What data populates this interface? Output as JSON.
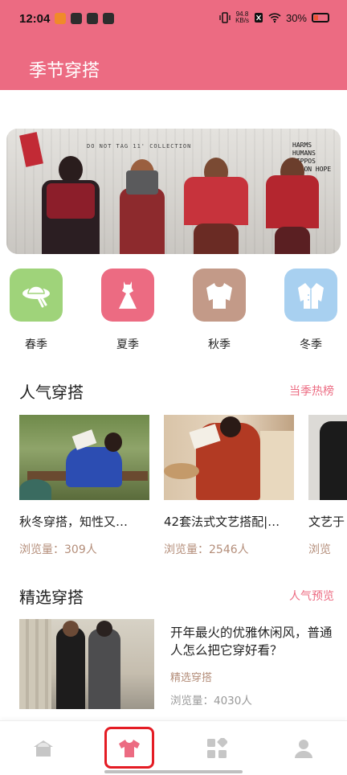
{
  "status_bar": {
    "time": "12:04",
    "speed_value": "94.8",
    "speed_unit": "KB/s",
    "battery": "30%"
  },
  "header": {
    "title": "季节穿搭"
  },
  "banner": {
    "caption": "DO NOT TAG 11' COLLECTION",
    "scribble": "HARMS HUMANS HIPPOS HERON HOPE"
  },
  "categories": [
    {
      "label": "春季",
      "color": "#9fd37a",
      "icon": "hat-icon"
    },
    {
      "label": "夏季",
      "color": "#ec6b82",
      "icon": "dress-icon"
    },
    {
      "label": "秋季",
      "color": "#c39a88",
      "icon": "sweater-icon"
    },
    {
      "label": "冬季",
      "color": "#a8d0f0",
      "icon": "coat-icon"
    }
  ],
  "popular": {
    "title": "人气穿搭",
    "link": "当季热榜",
    "items": [
      {
        "title": "秋冬穿搭，知性又…",
        "views": "浏览量：309人"
      },
      {
        "title": "42套法式文艺搭配|…",
        "views": "浏览量：2546人"
      },
      {
        "title": "文艺于",
        "views": "浏览"
      }
    ]
  },
  "featured": {
    "title": "精选穿搭",
    "link": "人气预览",
    "item": {
      "title": "开年最火的优雅休闲风，普通人怎么把它穿好看？",
      "tag": "精选穿搭",
      "views": "浏览量：4030人"
    }
  },
  "nav": {
    "items": [
      {
        "icon": "home-icon"
      },
      {
        "icon": "tshirt-icon",
        "active": true
      },
      {
        "icon": "grid-icon"
      },
      {
        "icon": "profile-icon"
      }
    ],
    "accent": "#ec6b82"
  }
}
